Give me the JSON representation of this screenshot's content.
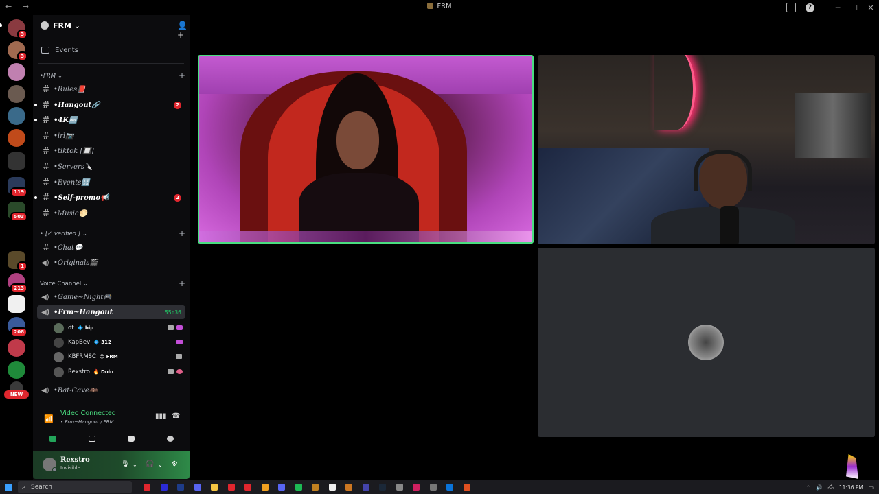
{
  "window": {
    "title": "FRM",
    "nav": "← →"
  },
  "server": {
    "name": "FRM"
  },
  "events_label": "Events",
  "rail": {
    "badges": [
      "3",
      "3",
      "119",
      "503",
      "1",
      "213",
      "208"
    ],
    "new_label": "NEW"
  },
  "categories": [
    {
      "label": "•FRM",
      "chevron": "⌄"
    },
    {
      "label": "[✓ verified ]",
      "chevron": "⌄"
    },
    {
      "label": "Voice Channel",
      "chevron": "⌄"
    }
  ],
  "text_channels": [
    {
      "name": "•Rules📕",
      "unread": false
    },
    {
      "name": "•Hangout🔗",
      "unread": true,
      "badge": "2"
    },
    {
      "name": "•4K🔤",
      "unread": true
    },
    {
      "name": "•irl📷",
      "unread": false
    },
    {
      "name": "•tiktok [🔲]",
      "unread": false
    },
    {
      "name": "•Servers🔪",
      "unread": false
    },
    {
      "name": "•Events🔢",
      "unread": false
    },
    {
      "name": "•Self-promo📢",
      "unread": true,
      "badge": "2"
    },
    {
      "name": "•Music🌕",
      "unread": false
    },
    {
      "name": "•Chat💬",
      "unread": false
    },
    {
      "name": "•Originals🎬",
      "unread": false
    }
  ],
  "voice_channels": [
    {
      "name": "•Game~Night🎮"
    },
    {
      "name": "•Frm~Hangout",
      "timer": "55:36",
      "active": true
    },
    {
      "name": "•Bat-Cave🦇"
    }
  ],
  "voice_users": [
    {
      "name": "dt",
      "tag": "💠 bip",
      "avatar_color": "#5a6b5a"
    },
    {
      "name": "KapBev",
      "tag": "💠 312",
      "avatar_color": "#444"
    },
    {
      "name": "KBFRMSC",
      "tag": "😊 FRM",
      "avatar_color": "#666"
    },
    {
      "name": "Rexstro",
      "tag": "🔥 Dolo",
      "avatar_color": "#555"
    }
  ],
  "voice_panel": {
    "status": "Video Connected",
    "location": "• Frm~Hangout / FRM"
  },
  "user": {
    "name": "Rexstro",
    "status": "Invisible"
  },
  "taskbar": {
    "search_placeholder": "Search",
    "time": "11:36 PM",
    "app_colors": [
      "#e0262e",
      "#2b2bd6",
      "#1e3c8a",
      "#5865f2",
      "#f5c542",
      "#e0262e",
      "#e0262e",
      "#f0a020",
      "#5865f2",
      "#1db954",
      "#c08020",
      "#f0f0f0",
      "#cc7722",
      "#4444aa",
      "#1b2838",
      "#888",
      "#d02060",
      "#777",
      "#0a74da",
      "#e05020"
    ]
  },
  "accent": {
    "green": "#4ade80",
    "red": "#e0262e",
    "online": "#23a55a"
  }
}
